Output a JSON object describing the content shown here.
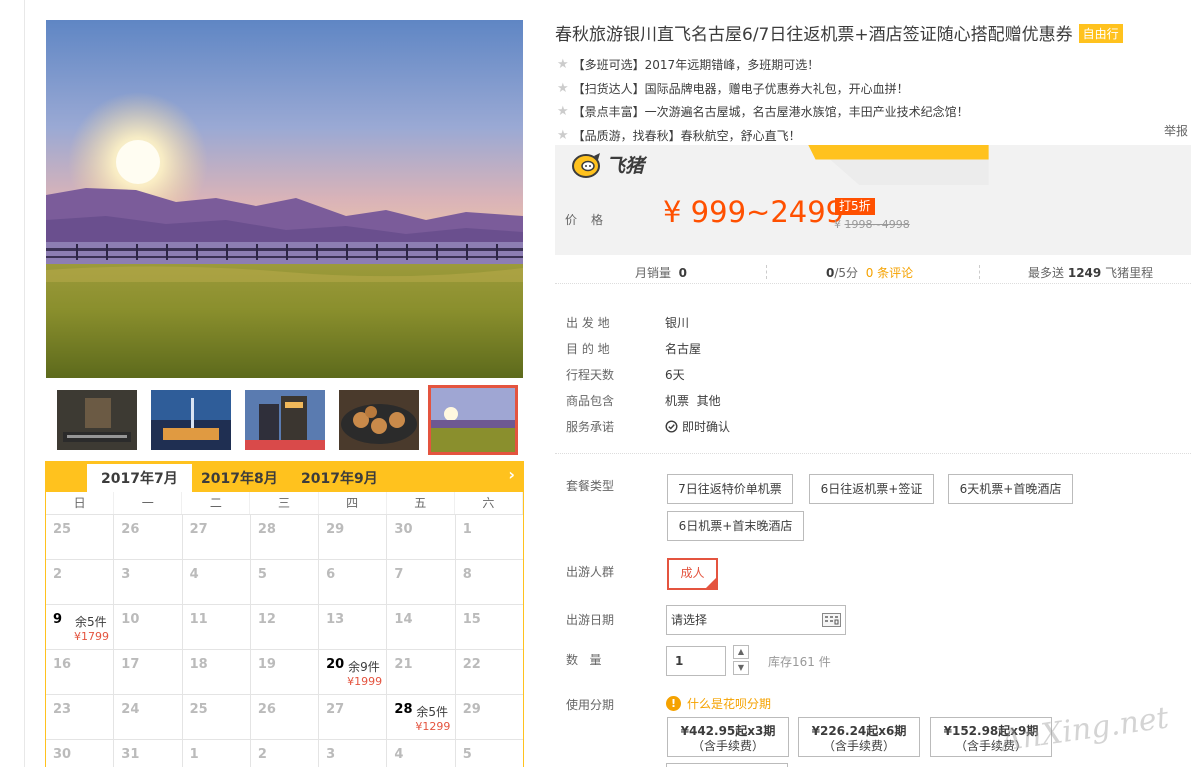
{
  "calendar": {
    "months": [
      "2017年7月",
      "2017年8月",
      "2017年9月"
    ],
    "weekdays": [
      "日",
      "一",
      "二",
      "三",
      "四",
      "五",
      "六"
    ],
    "weeks": [
      [
        {
          "d": "25"
        },
        {
          "d": "26"
        },
        {
          "d": "27"
        },
        {
          "d": "28"
        },
        {
          "d": "29"
        },
        {
          "d": "30"
        },
        {
          "d": "1"
        }
      ],
      [
        {
          "d": "2"
        },
        {
          "d": "3"
        },
        {
          "d": "4"
        },
        {
          "d": "5"
        },
        {
          "d": "6"
        },
        {
          "d": "7"
        },
        {
          "d": "8"
        }
      ],
      [
        {
          "d": "9",
          "stock": "余5件",
          "price": "¥1799"
        },
        {
          "d": "10"
        },
        {
          "d": "11"
        },
        {
          "d": "12"
        },
        {
          "d": "13"
        },
        {
          "d": "14"
        },
        {
          "d": "15"
        }
      ],
      [
        {
          "d": "16"
        },
        {
          "d": "17"
        },
        {
          "d": "18"
        },
        {
          "d": "19"
        },
        {
          "d": "20",
          "stock": "余9件",
          "price": "¥1999"
        },
        {
          "d": "21"
        },
        {
          "d": "22"
        }
      ],
      [
        {
          "d": "23"
        },
        {
          "d": "24"
        },
        {
          "d": "25"
        },
        {
          "d": "26"
        },
        {
          "d": "27"
        },
        {
          "d": "28",
          "stock": "余5件",
          "price": "¥1299"
        },
        {
          "d": "29"
        }
      ],
      [
        {
          "d": "30"
        },
        {
          "d": "31"
        },
        {
          "d": "1"
        },
        {
          "d": "2"
        },
        {
          "d": "3"
        },
        {
          "d": "4"
        },
        {
          "d": "5"
        }
      ]
    ]
  },
  "product": {
    "title": "春秋旅游银川直飞名古屋6/7日往返机票+酒店签证随心搭配赠优惠券",
    "tag": "自由行",
    "promos": [
      "【多班可选】2017年远期错峰，多班期可选！",
      "【扫货达人】国际品牌电器，赠电子优惠券大礼包，开心血拼！",
      "【景点丰富】一次游遍名古屋城，名古屋港水族馆，丰田产业技术纪念馆！",
      "【品质游，找春秋】春秋航空，舒心直飞！"
    ],
    "report": "举报"
  },
  "price": {
    "brand": "飞猪",
    "label": "价格",
    "value": "¥ 999~2499",
    "discount": "打5折",
    "original_prefix": "¥ ",
    "original": "1998~4998"
  },
  "stats": {
    "monthly_label": "月销量",
    "monthly_value": "0",
    "score_value": "0",
    "score_suffix": "/5分",
    "reviews": "0 条评论",
    "mileage_prefix": "最多送",
    "mileage_value": "1249",
    "mileage_suffix": "飞猪里程"
  },
  "attributes": [
    {
      "k": "出 发 地",
      "v": "银川"
    },
    {
      "k": "目 的 地",
      "v": "名古屋"
    },
    {
      "k": "行程天数",
      "v": "6天"
    },
    {
      "k": "商品包含",
      "v": "机票  其他"
    },
    {
      "k": "服务承诺",
      "v": "即时确认"
    }
  ],
  "options": {
    "package_label": "套餐类型",
    "packages": [
      "7日往返特价单机票",
      "6日往返机票+签证",
      "6天机票+首晚酒店",
      "6日机票+首末晚酒店"
    ],
    "traveler_label": "出游人群",
    "traveler": "成人",
    "date_label": "出游日期",
    "date_placeholder": "请选择",
    "qty_label": "数   量",
    "qty_value": "1",
    "stock": "库存161 件",
    "installment_label": "使用分期",
    "huabei_link": "什么是花呗分期",
    "installments": [
      {
        "amount": "¥442.95起x3期",
        "fee": "（含手续费）"
      },
      {
        "amount": "¥226.24起x6期",
        "fee": "（含手续费）"
      },
      {
        "amount": "¥152.98起x9期",
        "fee": "（含手续费）"
      }
    ]
  },
  "watermark": "AnXing.net",
  "colors": {
    "accent": "#ffc21e",
    "price": "#ff5000",
    "selected": "#e4543f"
  }
}
